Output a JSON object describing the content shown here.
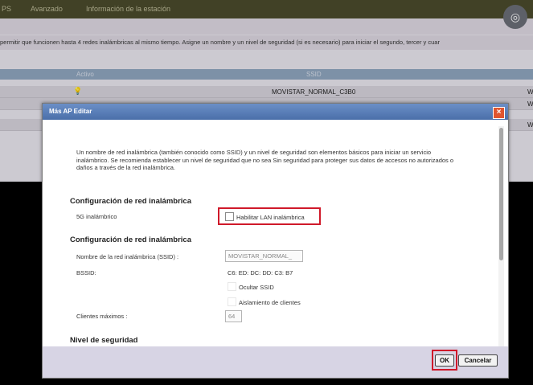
{
  "background": {
    "topnav": [
      "PS",
      "Avanzado",
      "Información de la estación"
    ],
    "description": "permitir que funcionen hasta 4 redes inalámbricas al mismo tiempo. Asigne un nombre y un nivel de seguridad (si es necesario) para iniciar el segundo, tercer y cuar",
    "table": {
      "headers": [
        "Activo",
        "SSID"
      ],
      "rows": [
        {
          "ssid": "MOVISTAR_NORMAL_C3B0",
          "edge": "W"
        },
        {
          "ssid": "",
          "edge": "W"
        },
        {
          "ssid": "",
          "edge": "W"
        }
      ]
    }
  },
  "modal": {
    "title": "Más AP Editar",
    "intro": "Un nombre de red inalámbrica (también conocido como SSID) y un nivel de seguridad son elementos básicos para iniciar un servicio inalámbrico. Se recomienda establecer un nivel de seguridad que no sea Sin seguridad para proteger sus datos de accesos no autorizados o daños a través de la red inalámbrica.",
    "section1": {
      "heading": "Configuración de red inalámbrica",
      "label": "5G inalámbrico",
      "checkbox_label": "Habilitar LAN inalámbrica",
      "checked": false
    },
    "section2": {
      "heading": "Configuración de red inalámbrica",
      "ssid_label": "Nombre de la red inalámbrica (SSID) :",
      "ssid_value": "MOVISTAR_NORMAL_",
      "bssid_label": "BSSID:",
      "bssid_value": "C6: ED: DC: DD: C3: B7",
      "hide_ssid_label": "Ocultar SSID",
      "isolation_label": "Aislamiento de clientes",
      "max_clients_label": "Clientes máximos :",
      "max_clients_value": "64"
    },
    "section3": {
      "heading": "Nivel de seguridad"
    },
    "ok_label": "OK",
    "cancel_label": "Cancelar"
  },
  "colors": {
    "highlight": "#d0192a",
    "title_bar": "#4a6fa9"
  }
}
